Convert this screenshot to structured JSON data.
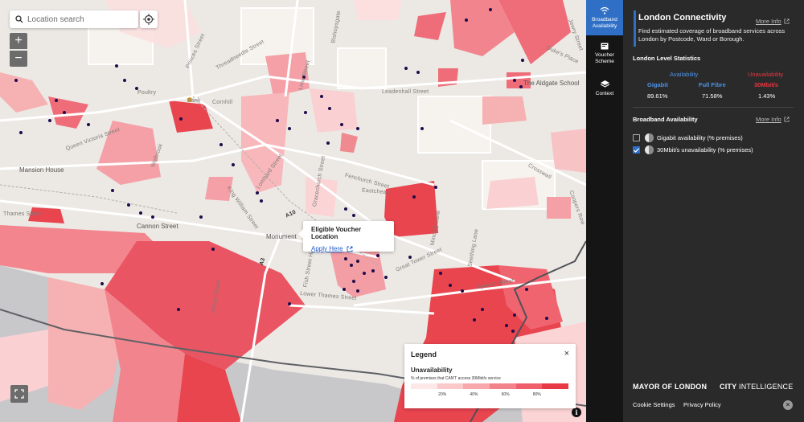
{
  "search": {
    "placeholder": "Location search"
  },
  "map_controls": {
    "zoom_in": "+",
    "zoom_out": "−",
    "info": "i"
  },
  "streets": [
    "Mansion House",
    "Thames Street",
    "Cannon Street",
    "Monument",
    "Cornhill",
    "Poultry",
    "Bank",
    "Fenchurch Street",
    "Gracechurch Street",
    "Lime Street",
    "Threadneedle Street",
    "Lower Thames Street",
    "Eastcheap",
    "Great Tower Street",
    "Byward Street",
    "The Aldgate School",
    "Leadenhall Street",
    "Crosswall",
    "Coopers Row",
    "Princes Street",
    "Queen Victoria Street",
    "King William Street",
    "Bishopsgate",
    "Walbrook",
    "Lombard Street",
    "Arthur Street",
    "Fish Street Hill",
    "Mincing Lane",
    "Seething Lane",
    "Jewry Street",
    "A10",
    "A3",
    "Duke's Place"
  ],
  "popup": {
    "title": "Eligible Voucher Location",
    "link": "Apply Here"
  },
  "legend": {
    "title": "Legend",
    "close": "×",
    "subtitle": "Unavailability",
    "description": "% of premises that CAN'T access 30Mbit/s service",
    "ticks": [
      "20%",
      "40%",
      "60%",
      "80%"
    ],
    "colors": [
      "#fde7e7",
      "#fbc9c9",
      "#f8a7ab",
      "#f3838b",
      "#ef5f6b",
      "#e83a44"
    ]
  },
  "tabs": [
    {
      "label": "Broadband Availability",
      "icon": "wifi-icon",
      "active": true
    },
    {
      "label": "Voucher Scheme",
      "icon": "voucher-icon",
      "active": false
    },
    {
      "label": "Context",
      "icon": "layers-icon",
      "active": false
    }
  ],
  "panel": {
    "title": "London Connectivity",
    "more_info": "More Info",
    "description": "Find estimated coverage of broadband services across London by Postcode, Ward or Borough.",
    "stats_title": "London Level Statistics",
    "availability_head": "Availability",
    "unavailability_head": "Unavailability",
    "stats": [
      {
        "label": "Gigabit",
        "value": "89.61%",
        "color": "#4d94e8"
      },
      {
        "label": "Full Fibre",
        "value": "71.58%",
        "color": "#4d94e8"
      },
      {
        "label": "30Mbit/s",
        "value": "1.43%",
        "color": "#e8363f"
      }
    ],
    "bb_title": "Broadband Availability",
    "bb_more": "More Info",
    "layers": [
      {
        "label": "Gigabit availability (% premises)",
        "checked": false
      },
      {
        "label": "30Mbit/s unavailability (% premises)",
        "checked": true
      }
    ],
    "brand_mayor": "MAYOR OF LONDON",
    "brand_city": "CITY",
    "brand_intel": "INTELLIGENCE",
    "cookie": "Cookie Settings",
    "privacy": "Privacy Policy",
    "close": "×"
  }
}
